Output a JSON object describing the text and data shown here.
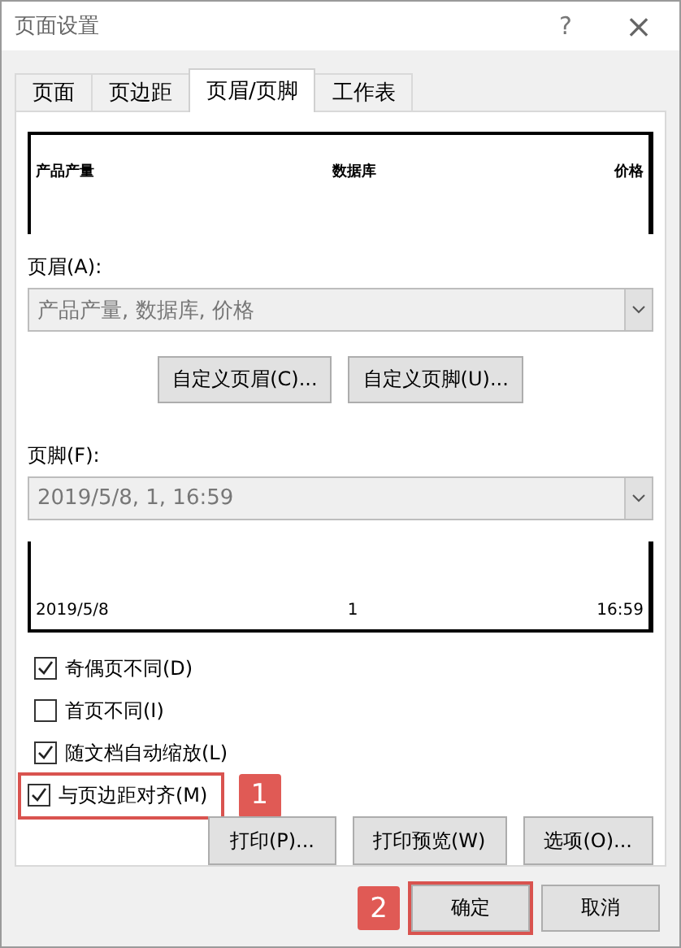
{
  "window": {
    "title": "页面设置",
    "help": "?",
    "close": "×"
  },
  "tabs": [
    {
      "label": "页面",
      "selected": false
    },
    {
      "label": "页边距",
      "selected": false
    },
    {
      "label": "页眉/页脚",
      "selected": true
    },
    {
      "label": "工作表",
      "selected": false
    }
  ],
  "header_preview": {
    "left": "产品产量",
    "center": "数据库",
    "right": "价格"
  },
  "header": {
    "label": "页眉(A):",
    "value": "产品产量, 数据库, 价格"
  },
  "custom_buttons": [
    "自定义页眉(C)...",
    "自定义页脚(U)..."
  ],
  "footer": {
    "label": "页脚(F):",
    "value": "2019/5/8, 1, 16:59"
  },
  "footer_preview": {
    "left": "2019/5/8",
    "center": "1",
    "right": "16:59"
  },
  "options": [
    {
      "label": "奇偶页不同(D)",
      "checked": true
    },
    {
      "label": "首页不同(I)",
      "checked": false
    },
    {
      "label": "随文档自动缩放(L)",
      "checked": true
    },
    {
      "label": "与页边距对齐(M)",
      "checked": true,
      "callout": "1"
    }
  ],
  "print_buttons": [
    "打印(P)...",
    "打印预览(W)",
    "选项(O)..."
  ],
  "dialog_buttons": [
    {
      "label": "确定",
      "callout": "2"
    },
    {
      "label": "取消"
    }
  ]
}
